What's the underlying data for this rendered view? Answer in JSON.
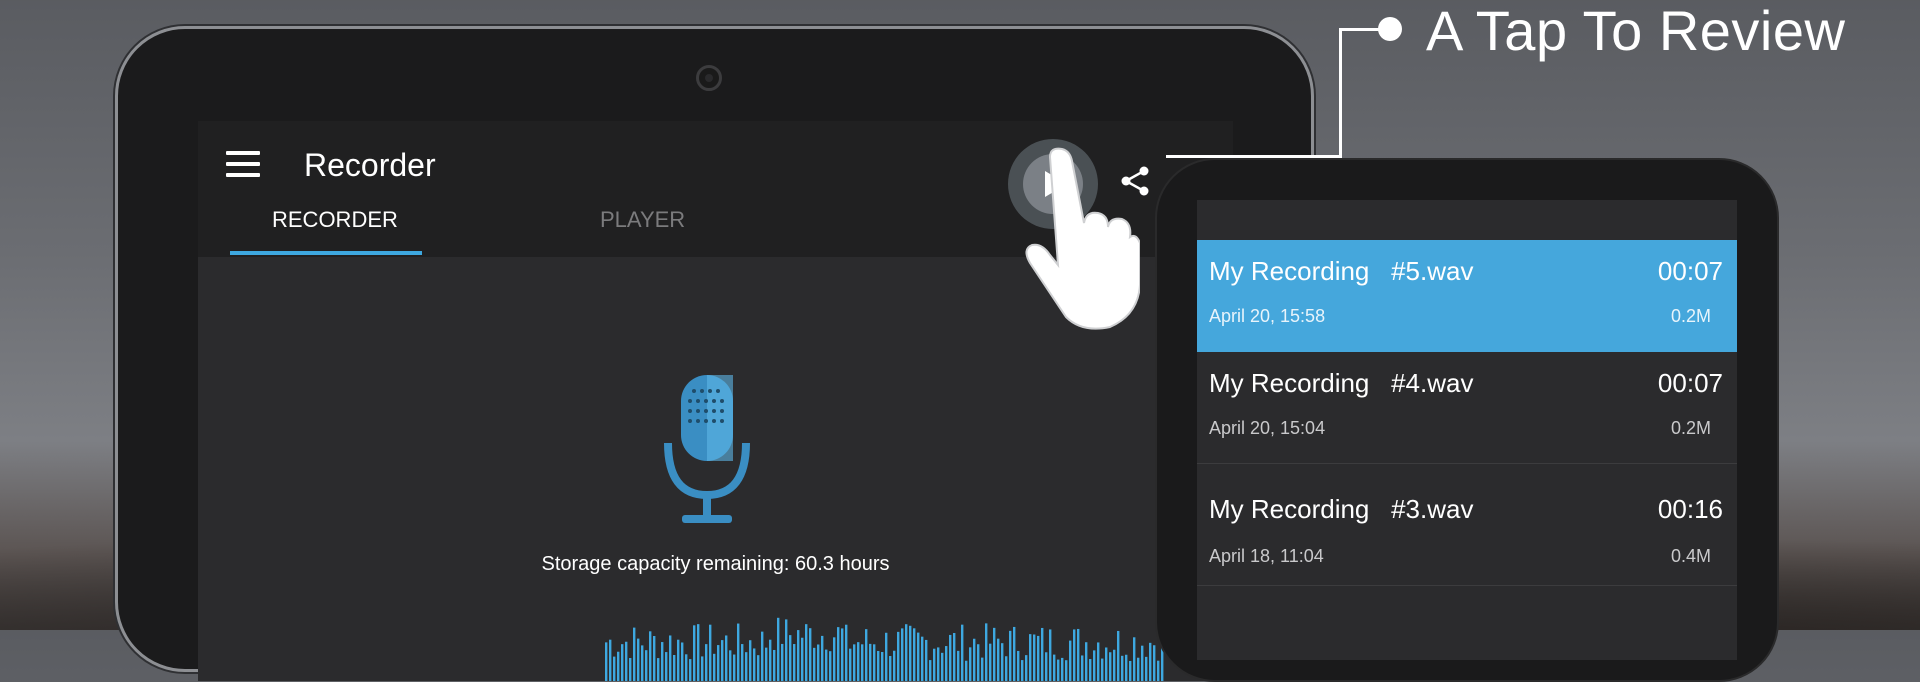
{
  "callout": {
    "text": "A Tap To Review"
  },
  "app": {
    "title": "Recorder",
    "tabs": [
      {
        "label": "RECORDER",
        "active": true
      },
      {
        "label": "PLAYER",
        "active": false
      }
    ],
    "storage_text": "Storage capacity remaining: 60.3 hours",
    "icons": {
      "menu": "hamburger-icon",
      "play": "play-icon",
      "share": "share-icon",
      "mic": "microphone-icon"
    },
    "accent_color": "#3ea8e0"
  },
  "recordings": [
    {
      "name": "My Recording   #5.wav",
      "duration": "00:07",
      "date": "April 20, 15:58",
      "size": "0.2M",
      "selected": true
    },
    {
      "name": "My Recording   #4.wav",
      "duration": "00:07",
      "date": "April 20, 15:04",
      "size": "0.2M",
      "selected": false
    },
    {
      "name": "My Recording   #3.wav",
      "duration": "00:16",
      "date": "April 18, 11:04",
      "size": "0.4M",
      "selected": false
    }
  ]
}
